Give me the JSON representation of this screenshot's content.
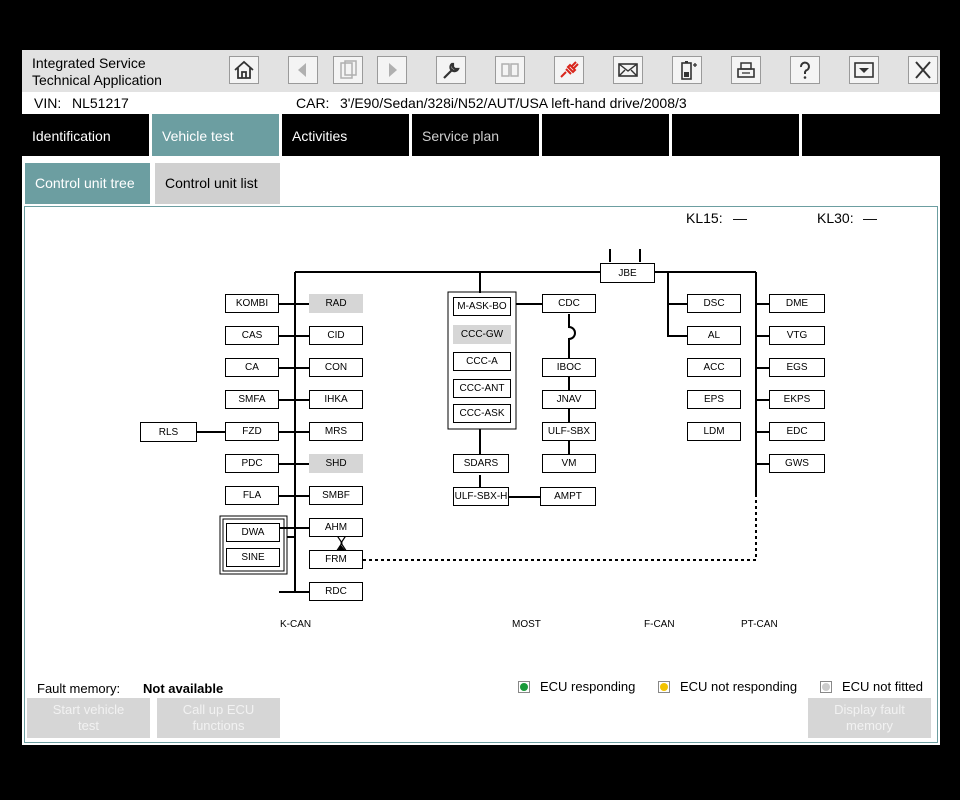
{
  "app": {
    "title_line1": "Integrated Service",
    "title_line2": "Technical Application"
  },
  "toolbar": {
    "icons": [
      "home-icon",
      "back-icon",
      "clipboard-icon",
      "forward-icon",
      "wrench-icon",
      "disconnect-icon",
      "plug-icon",
      "mail-icon",
      "battery-icon",
      "printer-icon",
      "help-icon",
      "collapse-icon",
      "close-icon"
    ]
  },
  "vehicle": {
    "vin_label": "VIN:",
    "vin": "NL51217",
    "car_label": "CAR:",
    "car": "3'/E90/Sedan/328i/N52/AUT/USA left-hand drive/2008/3"
  },
  "tabs": [
    "Identification",
    "Vehicle test",
    "Activities",
    "Service plan"
  ],
  "subtabs": [
    "Control unit tree",
    "Control unit list"
  ],
  "terminals": {
    "kl15_label": "KL15:",
    "kl15_value": "—",
    "kl30_label": "KL30:",
    "kl30_value": "—"
  },
  "ecus": {
    "jbe": "JBE",
    "rls": "RLS",
    "kombi": "KOMBI",
    "cas": "CAS",
    "ca": "CA",
    "smfa": "SMFA",
    "fzd": "FZD",
    "pdc": "PDC",
    "fla": "FLA",
    "dwa": "DWA",
    "sine": "SINE",
    "rad": "RAD",
    "cid": "CID",
    "con": "CON",
    "ihka": "IHKA",
    "mrs": "MRS",
    "shd": "SHD",
    "smbf": "SMBF",
    "ahm": "AHM",
    "frm": "FRM",
    "rdc": "RDC",
    "maskbo": "M-ASK-BO",
    "cccgw": "CCC-GW",
    "ccca": "CCC-A",
    "cccant": "CCC-ANT",
    "cccask": "CCC-ASK",
    "sdars": "SDARS",
    "ulfsbxh": "ULF-SBX-H",
    "cdc": "CDC",
    "iboc": "IBOC",
    "jnav": "JNAV",
    "ulfsbx": "ULF-SBX",
    "vm": "VM",
    "ampt": "AMPT",
    "dsc": "DSC",
    "al": "AL",
    "acc": "ACC",
    "eps": "EPS",
    "ldm": "LDM",
    "dme": "DME",
    "vtg": "VTG",
    "egs": "EGS",
    "ekps": "EKPS",
    "edc": "EDC",
    "gws": "GWS"
  },
  "buses": [
    "K-CAN",
    "MOST",
    "F-CAN",
    "PT-CAN"
  ],
  "fault_memory": {
    "label": "Fault memory:",
    "value": "Not available"
  },
  "legend": {
    "responding": "ECU responding",
    "not_responding": "ECU not responding",
    "not_fitted": "ECU not fitted",
    "responding_color": "#1a9a3a",
    "not_responding_color": "#f2c300",
    "not_fitted_color": "#cccccc"
  },
  "actions": {
    "start_line1": "Start vehicle",
    "start_line2": "test",
    "callup_line1": "Call up ECU",
    "callup_line2": "functions",
    "display_line1": "Display fault",
    "display_line2": "memory"
  },
  "colors": {
    "accent": "#6c9ea1",
    "plug_red": "#d9261c"
  }
}
